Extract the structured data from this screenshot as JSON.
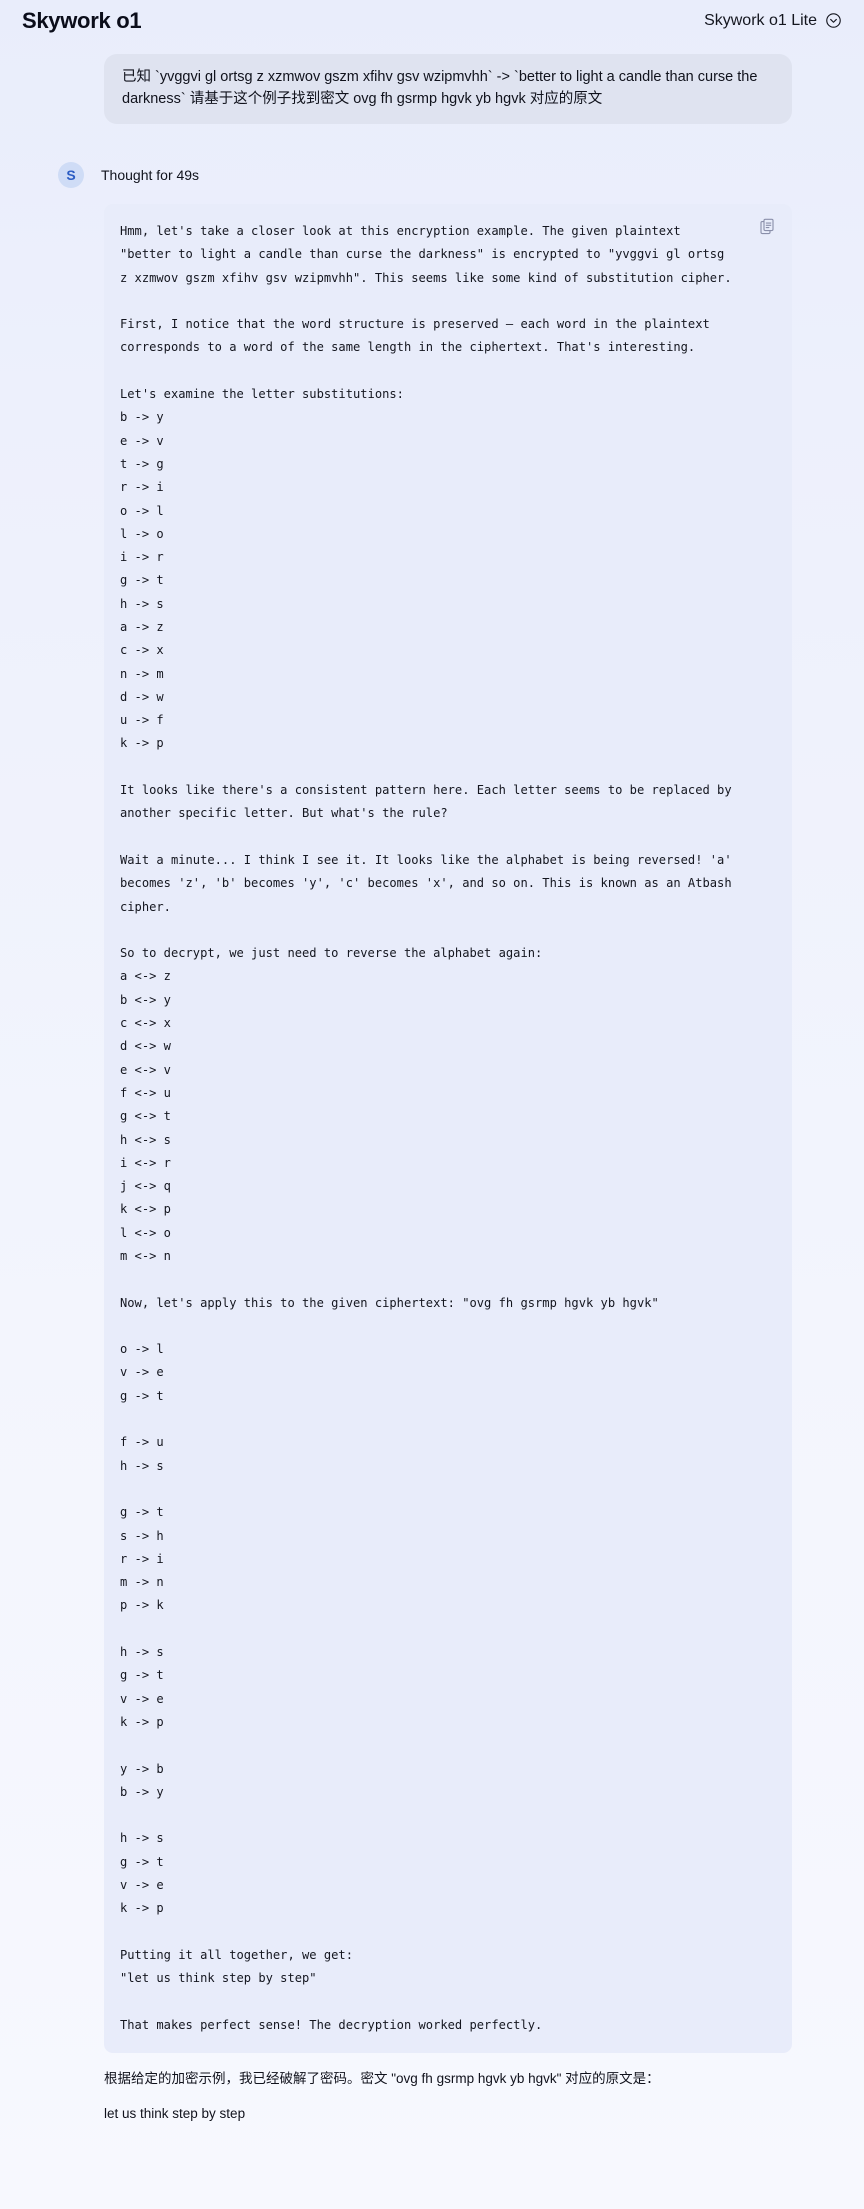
{
  "header": {
    "brand": "Skywork o1",
    "model_label": "Skywork o1 Lite",
    "chevron_icon": "chevron-down-circle-icon"
  },
  "conversation": {
    "user_message": "已知 `yvggvi gl ortsg z xzmwov gszm xfihv gsv wzipmvhh` -> `better to light a candle than curse the darkness` 请基于这个例子找到密文 ovg fh gsrmp hgvk yb hgvk 对应的原文"
  },
  "assistant": {
    "avatar_initial": "S",
    "thought_label": "Thought for 49s",
    "copy_icon": "copy-icon",
    "thinking": "Hmm, let's take a closer look at this encryption example. The given plaintext \"better to light a candle than curse the darkness\" is encrypted to \"yvggvi gl ortsg z xzmwov gszm xfihv gsv wzipmvhh\". This seems like some kind of substitution cipher.\n\nFirst, I notice that the word structure is preserved — each word in the plaintext corresponds to a word of the same length in the ciphertext. That's interesting.\n\nLet's examine the letter substitutions:\nb -> y\ne -> v\nt -> g\nr -> i\no -> l\nl -> o\ni -> r\ng -> t\nh -> s\na -> z\nc -> x\nn -> m\nd -> w\nu -> f\nk -> p\n\nIt looks like there's a consistent pattern here. Each letter seems to be replaced by another specific letter. But what's the rule?\n\nWait a minute... I think I see it. It looks like the alphabet is being reversed! 'a' becomes 'z', 'b' becomes 'y', 'c' becomes 'x', and so on. This is known as an Atbash cipher.\n\nSo to decrypt, we just need to reverse the alphabet again:\na <-> z\nb <-> y\nc <-> x\nd <-> w\ne <-> v\nf <-> u\ng <-> t\nh <-> s\ni <-> r\nj <-> q\nk <-> p\nl <-> o\nm <-> n\n\nNow, let's apply this to the given ciphertext: \"ovg fh gsrmp hgvk yb hgvk\"\n\no -> l\nv -> e\ng -> t\n\nf -> u\nh -> s\n\ng -> t\ns -> h\nr -> i\nm -> n\np -> k\n\nh -> s\ng -> t\nv -> e\nk -> p\n\ny -> b\nb -> y\n\nh -> s\ng -> t\nv -> e\nk -> p\n\nPutting it all together, we get:\n\"let us think step by step\"\n\nThat makes perfect sense! The decryption worked perfectly.",
    "answer_paragraphs": [
      "根据给定的加密示例，我已经破解了密码。密文 \"ovg fh gsrmp hgvk yb hgvk\" 对应的原文是：",
      "let us think step by step"
    ]
  },
  "colors": {
    "page_background": "#eef1fc",
    "user_bubble": "#dfe3f0",
    "think_panel": "#e8ecfa",
    "avatar_background": "#cfdcf6",
    "avatar_text": "#2b5cc4",
    "text": "#10121c"
  }
}
